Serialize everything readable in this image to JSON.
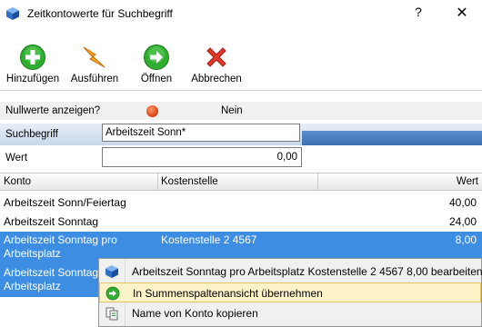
{
  "window": {
    "title": "Zeitkontowerte für Suchbegriff",
    "help_glyph": "?",
    "close_glyph": "✕"
  },
  "toolbar": {
    "add_label": "Hinzufügen",
    "run_label": "Ausführen",
    "open_label": "Öffnen",
    "cancel_label": "Abbrechen"
  },
  "filters": {
    "null_label": "Nullwerte anzeigen?",
    "null_value": "Nein",
    "search_label": "Suchbegriff",
    "search_value": "Arbeitszeit Sonn*",
    "value_label": "Wert",
    "value_value": "0,00"
  },
  "grid": {
    "headers": {
      "konto": "Konto",
      "kostenstelle": "Kostenstelle",
      "wert": "Wert"
    },
    "rows": [
      {
        "konto": "Arbeitszeit Sonn/Feiertag",
        "kostenstelle": "",
        "wert": "40,00"
      },
      {
        "konto": "Arbeitszeit Sonntag",
        "kostenstelle": "",
        "wert": "24,00"
      },
      {
        "konto_line1": "Arbeitszeit Sonntag pro",
        "konto_line2": "Arbeitsplatz",
        "kostenstelle": "Kostenstelle 2 4567",
        "wert": "8,00"
      },
      {
        "konto_line1": "Arbeitszeit Sonntag pro",
        "konto_line2": "Arbeitsplatz"
      }
    ]
  },
  "context_menu": {
    "items": [
      {
        "label": "Arbeitszeit Sonntag pro Arbeitsplatz Kostenstelle 2 4567 8,00  bearbeiten",
        "icon": "cube-icon"
      },
      {
        "label": "In Summenspaltenansicht übernehmen",
        "icon": "arrow-right-circle-icon"
      },
      {
        "label": "Name von Konto kopieren",
        "icon": "copy-icon"
      }
    ]
  },
  "colors": {
    "selection": "#3d8ee3",
    "menu_highlight": "#fdf3c8",
    "add_green": "#2fae2f",
    "cancel_red": "#e03a2a"
  }
}
